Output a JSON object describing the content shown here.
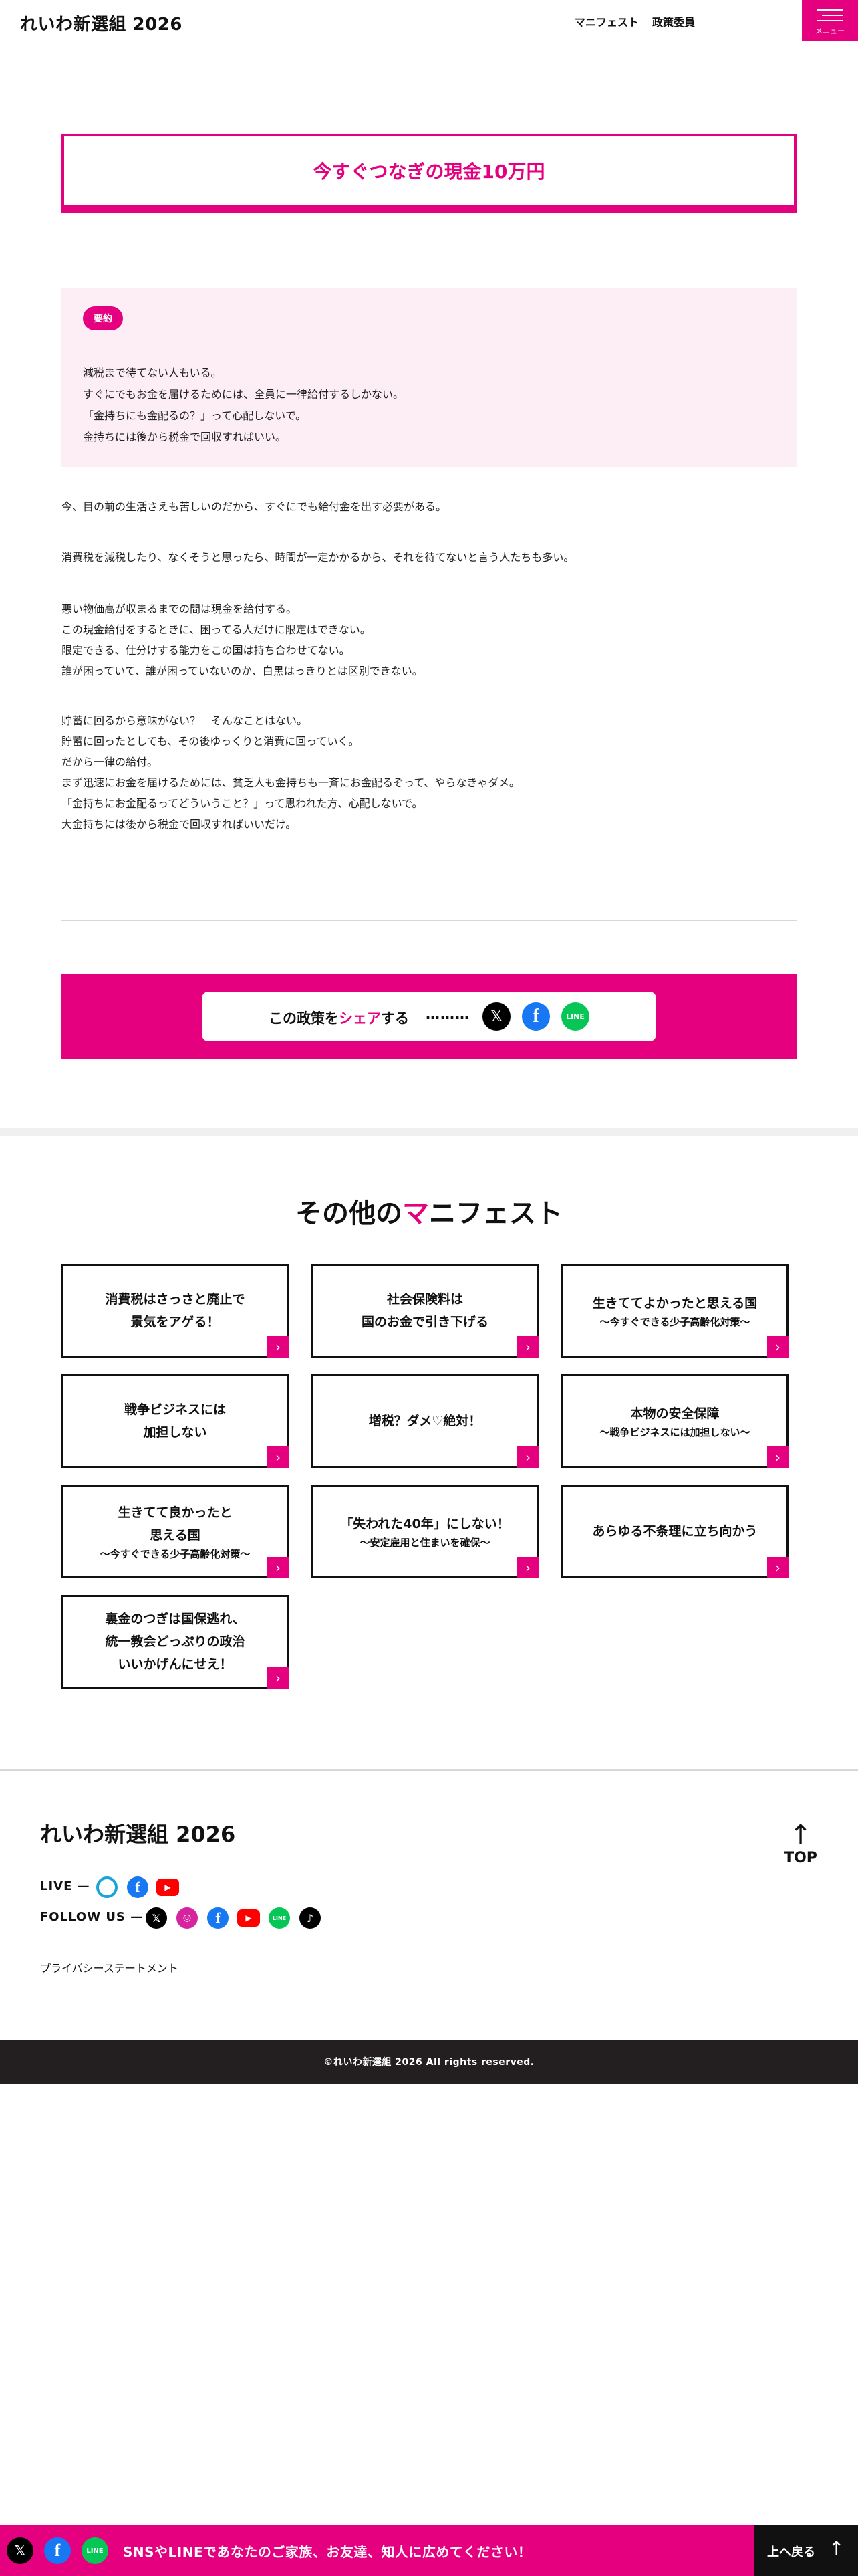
{
  "header": {
    "site_title": "れいわ新選組 2026",
    "nav": [
      "マニフェスト",
      "政策委員"
    ],
    "menu_label": "メニュー"
  },
  "article": {
    "title": "今すぐつなぎの現金10万円",
    "summary_badge": "要約",
    "summary_lines": [
      "減税まで待てない人もいる。",
      "すぐにでもお金を届けるためには、全員に一律給付するしかない。",
      "「金持ちにも金配るの？」って心配しないで。",
      "金持ちには後から税金で回収すればいい。"
    ],
    "paragraphs": [
      [
        "今、目の前の生活さえも苦しいのだから、すぐにでも給付金を出す必要がある。"
      ],
      [
        "消費税を減税したり、なくそうと思ったら、時間が一定かかるから、それを待てないと言う人たちも多い。"
      ],
      [
        "悪い物価高が収まるまでの間は現金を給付する。",
        "この現金給付をするときに、困ってる人だけに限定はできない。",
        "限定できる、仕分けする能力をこの国は持ち合わせてない。",
        "誰が困っていて、誰が困っていないのか、白黒はっきりとは区別できない。"
      ],
      [
        "貯蓄に回るから意味がない？　そんなことはない。",
        "貯蓄に回ったとしても、その後ゆっくりと消費に回っていく。",
        "だから一律の給付。",
        "まず迅速にお金を届けるためには、貧乏人も金持ちも一斉にお金配るぞって、やらなきゃダメ。",
        "「金持ちにお金配るってどういうこと？」って思われた方、心配しないで。",
        "大金持ちには後から税金で回収すればいいだけ。"
      ]
    ]
  },
  "share": {
    "text_before": "この政策を",
    "text_highlight": "シェア",
    "text_after": "する",
    "dots": "………",
    "icons": [
      "x-icon",
      "facebook-icon",
      "line-icon"
    ]
  },
  "other": {
    "heading_before": "その他の",
    "heading_highlight": "マ",
    "heading_after": "ニフェスト",
    "cards": [
      {
        "title": "消費税はさっさと廃止で\n景気をアゲる！",
        "sub": ""
      },
      {
        "title": "社会保険料は\n国のお金で引き下げる",
        "sub": ""
      },
      {
        "title": "生きててよかったと思える国",
        "sub": "〜今すぐできる少子高齢化対策〜"
      },
      {
        "title": "戦争ビジネスには\n加担しない",
        "sub": ""
      },
      {
        "title": "増税？ダメ♡絶対！",
        "sub": ""
      },
      {
        "title": "本物の安全保障",
        "sub": "〜戦争ビジネスには加担しない〜"
      },
      {
        "title": "生きてて良かったと\n思える国",
        "sub": "〜今すぐできる少子高齢化対策〜"
      },
      {
        "title": "「失われた40年」にしない！",
        "sub": "〜安定雇用と住まいを確保〜"
      },
      {
        "title": "あらゆる不条理に立ち向かう",
        "sub": ""
      },
      {
        "title": "裏金のつぎは国保逃れ、\n統一教会どっぷりの政治\nいいかげんにせえ！",
        "sub": ""
      }
    ],
    "arrow": "›"
  },
  "footer": {
    "title": "れいわ新選組 2026",
    "live_label": "LIVE —",
    "follow_label": "FOLLOW US —",
    "privacy": "プライバシーステートメント",
    "top_label": "TOP",
    "copyright": "©れいわ新選組 2026 All rights reserved."
  },
  "bottom_bar": {
    "text": "SNSやLINEであなたのご家族、お友達、知人に広めてください！",
    "back_top": "上へ戻る"
  },
  "colors": {
    "accent": "#e4007f",
    "summary_bg": "#fdeef5",
    "dark": "#231f20"
  }
}
